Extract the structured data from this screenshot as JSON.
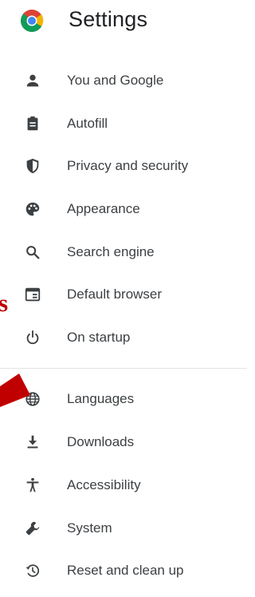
{
  "header": {
    "title": "Settings",
    "logo_icon": "chrome-logo-icon"
  },
  "sidebar": {
    "items": [
      {
        "label": "You and Google",
        "icon": "person-icon"
      },
      {
        "label": "Autofill",
        "icon": "clipboard-icon"
      },
      {
        "label": "Privacy and security",
        "icon": "shield-icon"
      },
      {
        "label": "Appearance",
        "icon": "palette-icon"
      },
      {
        "label": "Search engine",
        "icon": "search-icon"
      },
      {
        "label": "Default browser",
        "icon": "browser-window-icon"
      },
      {
        "label": "On startup",
        "icon": "power-icon"
      },
      {
        "label": "Languages",
        "icon": "globe-icon"
      },
      {
        "label": "Downloads",
        "icon": "download-icon"
      },
      {
        "label": "Accessibility",
        "icon": "accessibility-icon"
      },
      {
        "label": "System",
        "icon": "wrench-icon"
      },
      {
        "label": "Reset and clean up",
        "icon": "restore-icon"
      }
    ]
  },
  "annotation": {
    "text": "s",
    "color": "#c00000"
  },
  "colors": {
    "icon": "#3c4043",
    "text": "#3c4043",
    "title": "#202124",
    "annotation_arrow": "#c00000"
  }
}
